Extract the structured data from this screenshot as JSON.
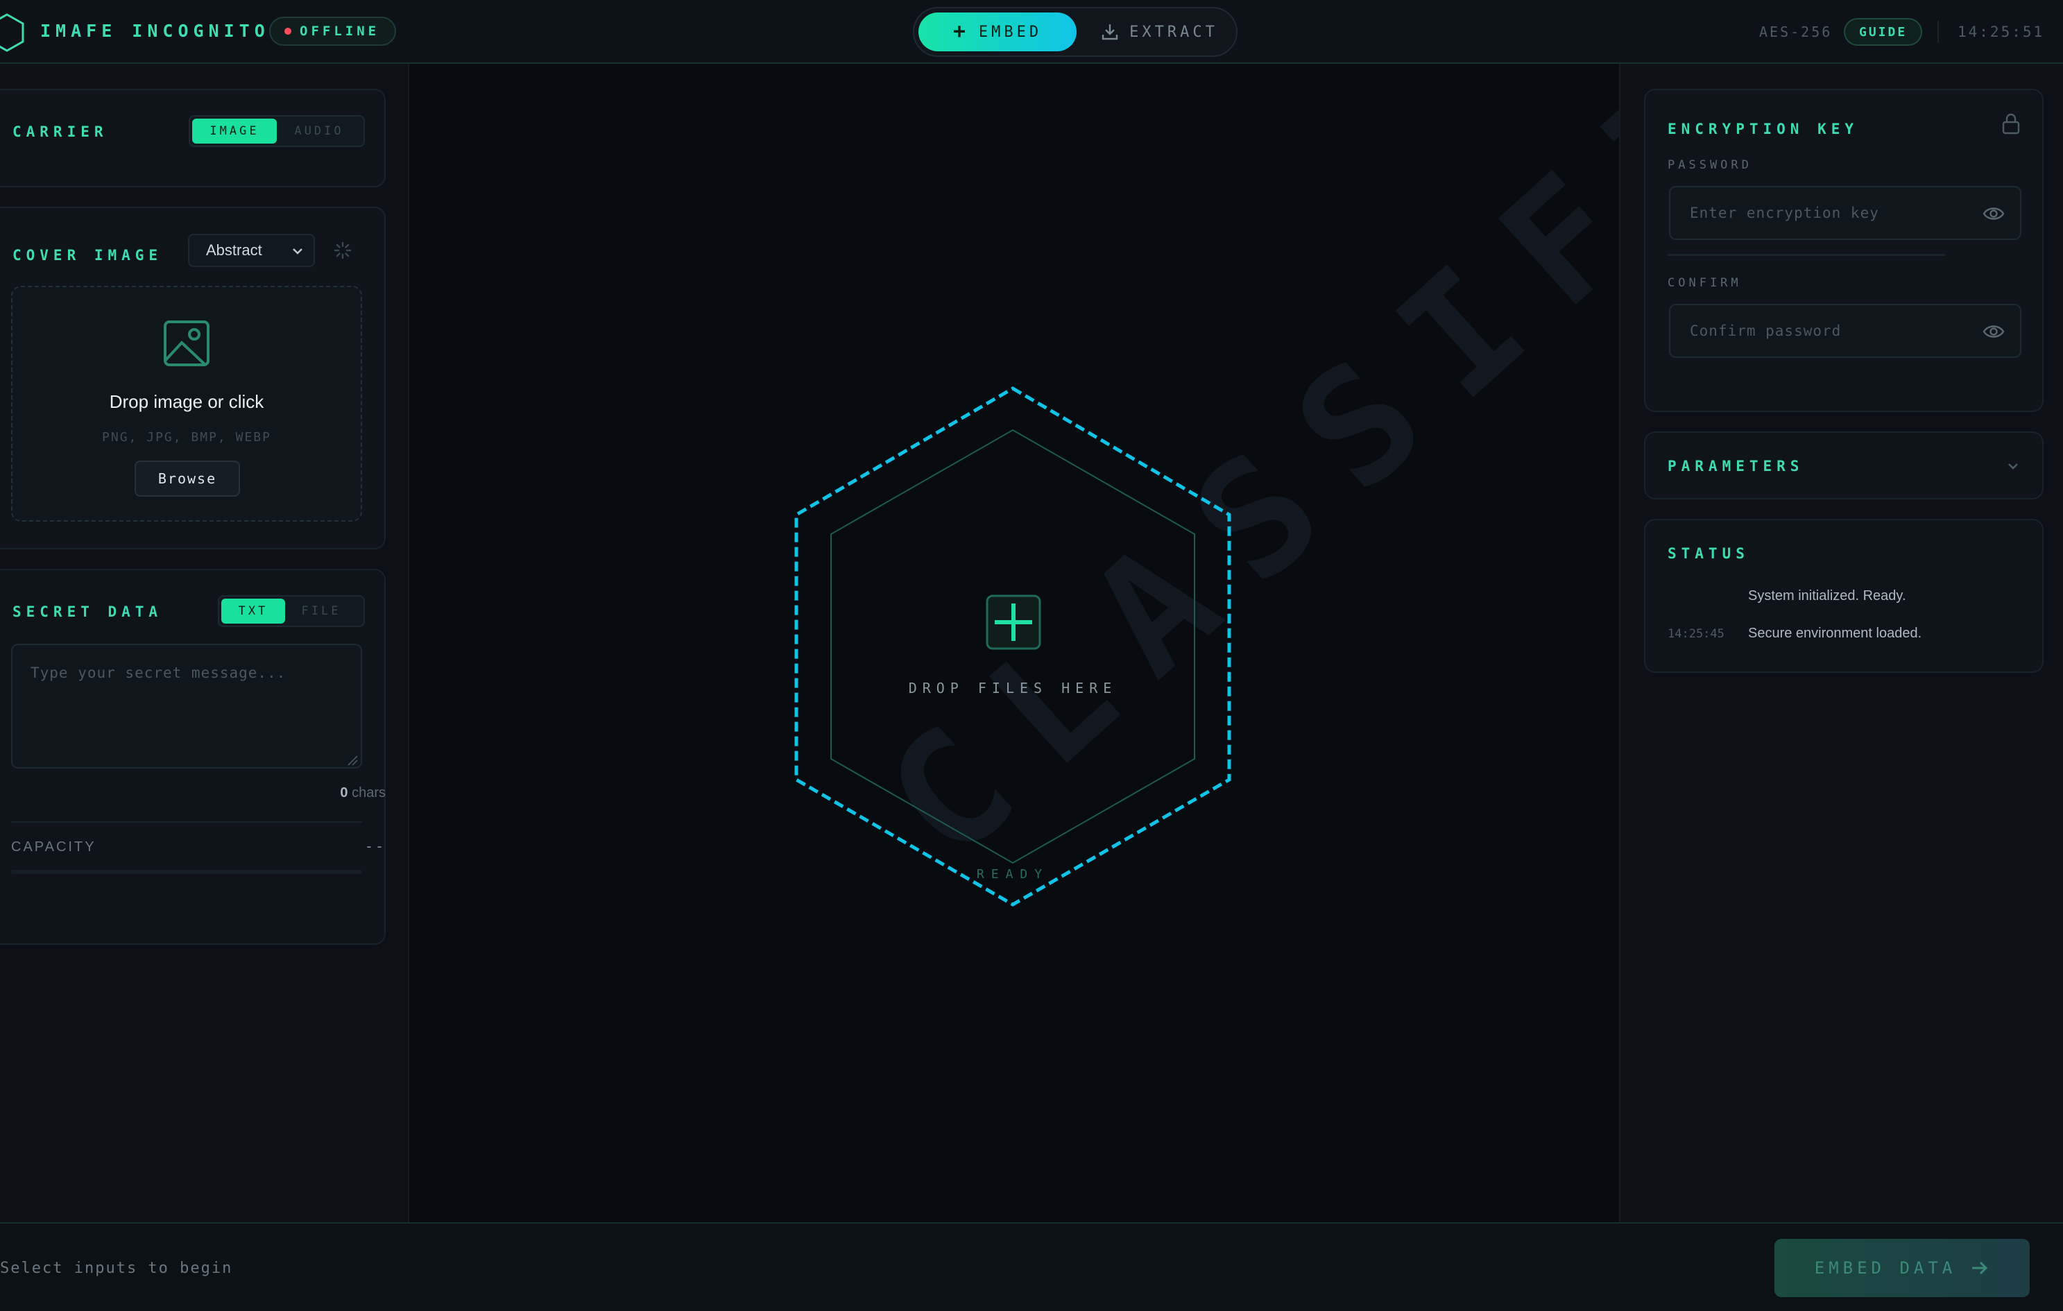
{
  "header": {
    "app_title": "IMAFE INCOGNITO",
    "offline_label": "OFFLINE",
    "mode_embed": "EMBED",
    "mode_extract": "EXTRACT",
    "cipher": "AES-256",
    "guide": "GUIDE",
    "time": "14:25:51"
  },
  "left": {
    "carrier_title": "CARRIER",
    "carrier_options": [
      "IMAGE",
      "AUDIO"
    ],
    "cover_title": "COVER IMAGE",
    "cover_style": "Abstract",
    "drop_title": "Drop image or click",
    "drop_types": "PNG, JPG, BMP, WEBP",
    "browse": "Browse",
    "secret_title": "SECRET DATA",
    "secret_options": [
      "TXT",
      "FILE"
    ],
    "secret_placeholder": "Type your secret message...",
    "char_count": "0",
    "char_unit": "chars",
    "capacity_label": "CAPACITY",
    "capacity_value": "--",
    "capacity_fraction": 0
  },
  "center": {
    "watermark": "CLASSIFIED",
    "drop_label": "DROP FILES HERE",
    "ready_label": "READY"
  },
  "right": {
    "enc_title": "ENCRYPTION KEY",
    "password_label": "PASSWORD",
    "password_placeholder": "Enter encryption key",
    "confirm_label": "CONFIRM",
    "confirm_placeholder": "Confirm password",
    "params_title": "PARAMETERS",
    "status_title": "STATUS",
    "status_log": [
      {
        "time": "",
        "message": "System initialized. Ready."
      },
      {
        "time": "14:25:45",
        "message": "Secure environment loaded."
      }
    ]
  },
  "footer": {
    "status": "Select inputs to begin",
    "embed_button": "EMBED DATA"
  },
  "colors": {
    "accent": "#3fdcb0",
    "accent_cyan": "#10c4e8",
    "background": "#0a0d12",
    "error_dot": "#ff4d5e"
  }
}
